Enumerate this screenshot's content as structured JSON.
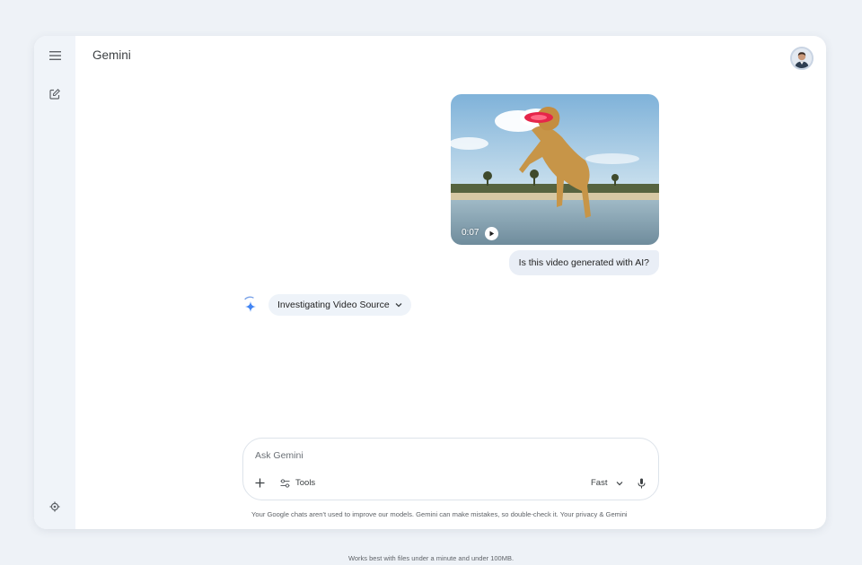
{
  "app": {
    "title": "Gemini"
  },
  "sidebar": {
    "menu_icon": "hamburger-menu-icon",
    "new_chat_icon": "edit-new-chat-icon",
    "settings_icon": "gear-icon"
  },
  "conversation": {
    "video": {
      "duration": "0:07",
      "play_icon": "play-icon"
    },
    "user_message": "Is this video generated with AI?",
    "assistant_status": {
      "label": "Investigating Video Source",
      "icon": "gemini-sparkle-icon"
    }
  },
  "composer": {
    "placeholder": "Ask Gemini",
    "add_icon": "plus-icon",
    "tools_label": "Tools",
    "tools_icon": "tune-sliders-icon",
    "model_label": "Fast",
    "mic_icon": "microphone-icon"
  },
  "disclaimer": "Your Google chats aren't used to improve our models. Gemini can make mistakes, so double-check it. Your privacy & Gemini",
  "footer_note": "Works best with files under a minute and under 100MB.",
  "colors": {
    "background": "#eef2f7",
    "rail": "#f0f4f9",
    "bubble": "#e9eef6",
    "gemini_blue": "#4285f4"
  }
}
